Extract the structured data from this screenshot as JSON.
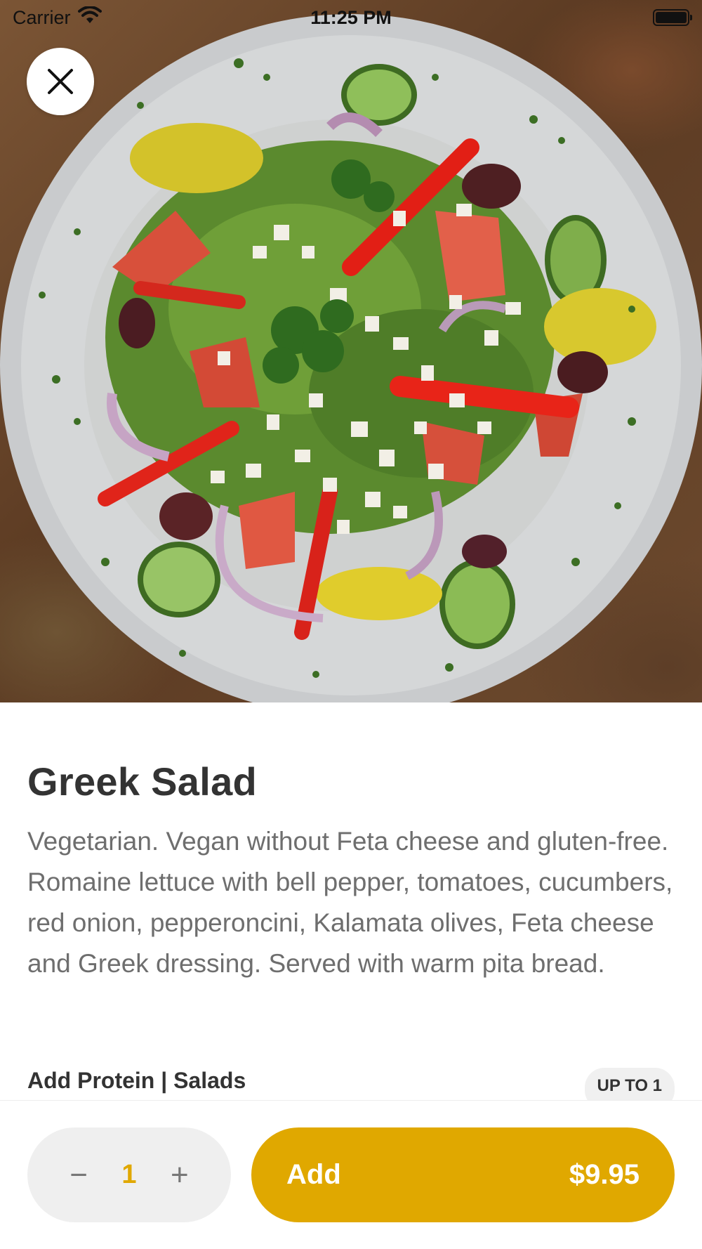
{
  "status_bar": {
    "carrier": "Carrier",
    "time": "11:25 PM"
  },
  "item": {
    "title": "Greek Salad",
    "description": "Vegetarian. Vegan without Feta cheese and gluten-free. Romaine lettuce with bell pepper, tomatoes, cucumbers, red onion, pepperoncini, Kalamata olives, Feta cheese and Greek dressing. Served with warm pita bread."
  },
  "options": {
    "section_title": "Add Protein | Salads",
    "limit_badge": "UP TO 1"
  },
  "order": {
    "quantity": "1",
    "decrement_symbol": "−",
    "increment_symbol": "+",
    "add_label": "Add",
    "price": "$9.95"
  },
  "colors": {
    "accent": "#e0a800",
    "stepper_bg": "#efefef",
    "title_text": "#333333",
    "body_text": "#6e6e6e"
  },
  "icons": {
    "close": "close-icon",
    "wifi": "wifi-icon",
    "battery": "battery-icon"
  }
}
